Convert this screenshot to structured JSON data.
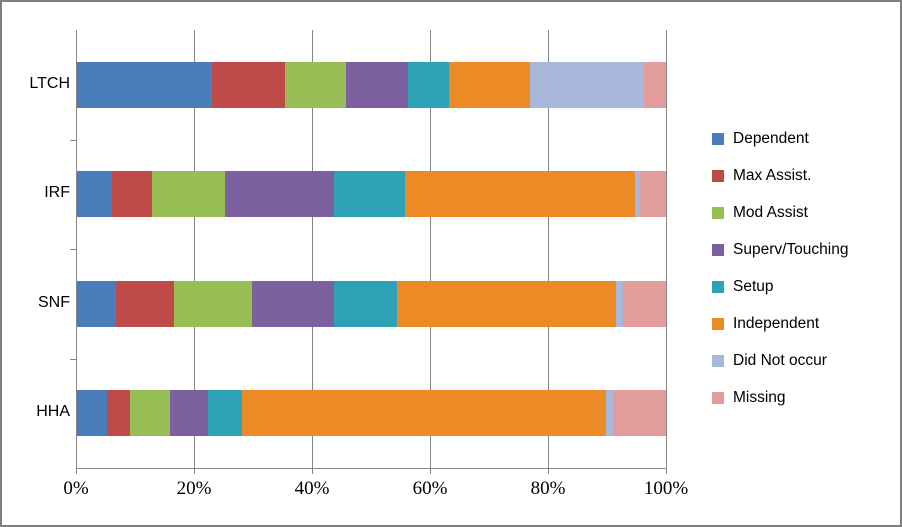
{
  "chart_data": {
    "type": "bar",
    "orientation": "horizontal",
    "stacked": true,
    "normalized": "100%",
    "title": "",
    "xlabel": "",
    "ylabel": "",
    "xlim": [
      0,
      100
    ],
    "xticks": [
      "0%",
      "20%",
      "40%",
      "60%",
      "80%",
      "100%"
    ],
    "xtick_values": [
      0,
      20,
      40,
      60,
      80,
      100
    ],
    "grid": true,
    "legend_position": "right",
    "categories": [
      "LTCH",
      "IRF",
      "SNF",
      "HHA"
    ],
    "series": [
      {
        "name": "Dependent",
        "color": "#4a7ebb",
        "values": [
          23.1,
          6.1,
          6.8,
          5.3
        ]
      },
      {
        "name": "Max Assist.",
        "color": "#be4b48",
        "values": [
          12.4,
          6.8,
          9.8,
          3.9
        ]
      },
      {
        "name": "Mod Assist",
        "color": "#98bf55",
        "values": [
          10.2,
          12.4,
          13.2,
          6.8
        ]
      },
      {
        "name": "Superv/Touching",
        "color": "#7d60a0",
        "values": [
          10.5,
          18.5,
          13.9,
          6.3
        ]
      },
      {
        "name": "Setup",
        "color": "#2ea2b6",
        "values": [
          7.1,
          12.0,
          10.7,
          5.9
        ]
      },
      {
        "name": "Independent",
        "color": "#ec8a25",
        "values": [
          13.7,
          38.9,
          37.1,
          61.7
        ]
      },
      {
        "name": "Did Not occur",
        "color": "#a7b8db",
        "values": [
          19.3,
          0.9,
          1.2,
          1.2
        ]
      },
      {
        "name": "Missing",
        "color": "#e39c9c",
        "values": [
          3.7,
          4.4,
          7.3,
          8.9
        ]
      }
    ]
  },
  "legend": {
    "items": [
      {
        "label": "Dependent",
        "color": "#4a7ebb"
      },
      {
        "label": "Max Assist.",
        "color": "#be4b48"
      },
      {
        "label": "Mod Assist",
        "color": "#98bf55"
      },
      {
        "label": "Superv/Touching",
        "color": "#7d60a0"
      },
      {
        "label": "Setup",
        "color": "#2ea2b6"
      },
      {
        "label": "Independent",
        "color": "#ec8a25"
      },
      {
        "label": "Did Not occur",
        "color": "#a7b8db"
      },
      {
        "label": "Missing",
        "color": "#e39c9c"
      }
    ]
  },
  "axis": {
    "category_labels": [
      "LTCH",
      "IRF",
      "SNF",
      "HHA"
    ],
    "x_tick_labels": [
      "0%",
      "20%",
      "40%",
      "60%",
      "80%",
      "100%"
    ]
  },
  "style": {
    "gridline_color": "#868686",
    "border_color": "#7f7f7f",
    "background": "#ffffff"
  }
}
